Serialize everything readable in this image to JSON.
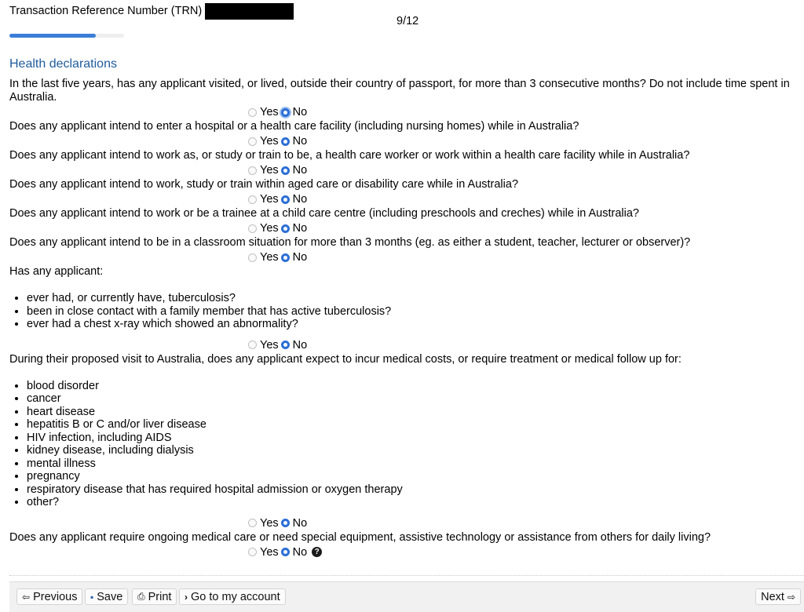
{
  "header": {
    "trn_label": "Transaction Reference Number (TRN)",
    "page_counter": "9/12",
    "progress_fraction": 0.75
  },
  "section": {
    "title": "Health declarations"
  },
  "options": {
    "yes": "Yes",
    "no": "No"
  },
  "questions": [
    {
      "text": "In the last five years, has any applicant visited, or lived, outside their country of passport, for more than 3 consecutive months? Do not include time spent in Australia.",
      "selected": "No"
    },
    {
      "text": "Does any applicant intend to enter a hospital or a health care facility (including nursing homes) while in Australia?",
      "selected": "No"
    },
    {
      "text": "Does any applicant intend to work as, or study or train to be, a health care worker or work within a health care facility while in Australia?",
      "selected": "No"
    },
    {
      "text": "Does any applicant intend to work, study or train within aged care or disability care while in Australia?",
      "selected": "No"
    },
    {
      "text": "Does any applicant intend to work or be a trainee at a child care centre (including preschools and creches) while in Australia?",
      "selected": "No"
    },
    {
      "text": "Does any applicant intend to be in a classroom situation for more than 3 months (eg. as either a student, teacher, lecturer or observer)?",
      "selected": "No"
    },
    {
      "text": "Has any applicant:",
      "bullets": [
        "ever had, or currently have, tuberculosis?",
        "been in close contact with a family member that has active tuberculosis?",
        "ever had a chest x-ray which showed an abnormality?"
      ],
      "selected": "No"
    },
    {
      "text": "During their proposed visit to Australia, does any applicant expect to incur medical costs, or require treatment or medical follow up for:",
      "bullets": [
        "blood disorder",
        "cancer",
        "heart disease",
        "hepatitis B or C and/or liver disease",
        "HIV infection, including AIDS",
        "kidney disease, including dialysis",
        "mental illness",
        "pregnancy",
        "respiratory disease that has required hospital admission or oxygen therapy",
        "other?"
      ],
      "selected": "No"
    },
    {
      "text": "Does any applicant require ongoing medical care or need special equipment, assistive technology or assistance from others for daily living?",
      "selected": "No",
      "help": "?"
    }
  ],
  "footer": {
    "previous": "Previous",
    "save": "Save",
    "print": "Print",
    "account": "Go to my account",
    "next": "Next"
  },
  "icons": {
    "previous": "arrow-left-icon",
    "save": "floppy-disk-icon",
    "print": "printer-icon",
    "account": "chevron-right-icon",
    "next": "arrow-right-icon",
    "help": "question-circle-icon"
  },
  "colors": {
    "accent": "#3b7ed8",
    "title": "#1f5c9e"
  }
}
